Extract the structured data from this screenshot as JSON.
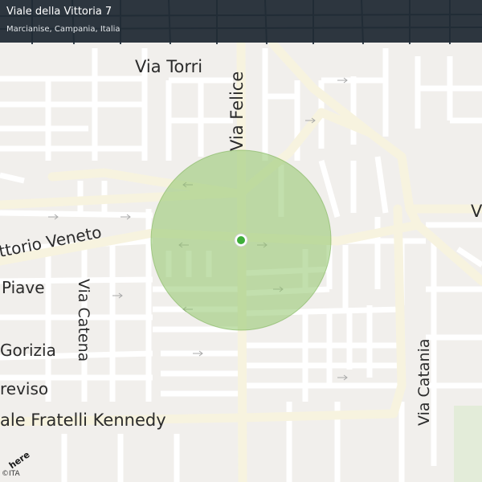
{
  "location": {
    "address_line": "Viale della Vittoria 7",
    "city_line": "Marcianise, Campania, Italia"
  },
  "map": {
    "provider_logo": "here",
    "copyright": "©ITA",
    "accuracy_circle_color": "#8fc46a",
    "position_dot_color": "#3fae3a",
    "road_color": "#ffffff",
    "major_road_color": "#f7f3df",
    "background_color": "#f1efec",
    "street_labels": {
      "via_torri": "Via  Torri",
      "via_felice": "Via  Felice",
      "vittorio_veneto": "ttorio  Veneto",
      "piave": "Piave",
      "via_catena": "Via  Catena",
      "gorizia": "Gorizia",
      "treviso": "reviso",
      "fratelli_kennedy": "ale  Fratelli  Kennedy",
      "via_catania": "Via  Catania",
      "right_edge": "V"
    }
  }
}
